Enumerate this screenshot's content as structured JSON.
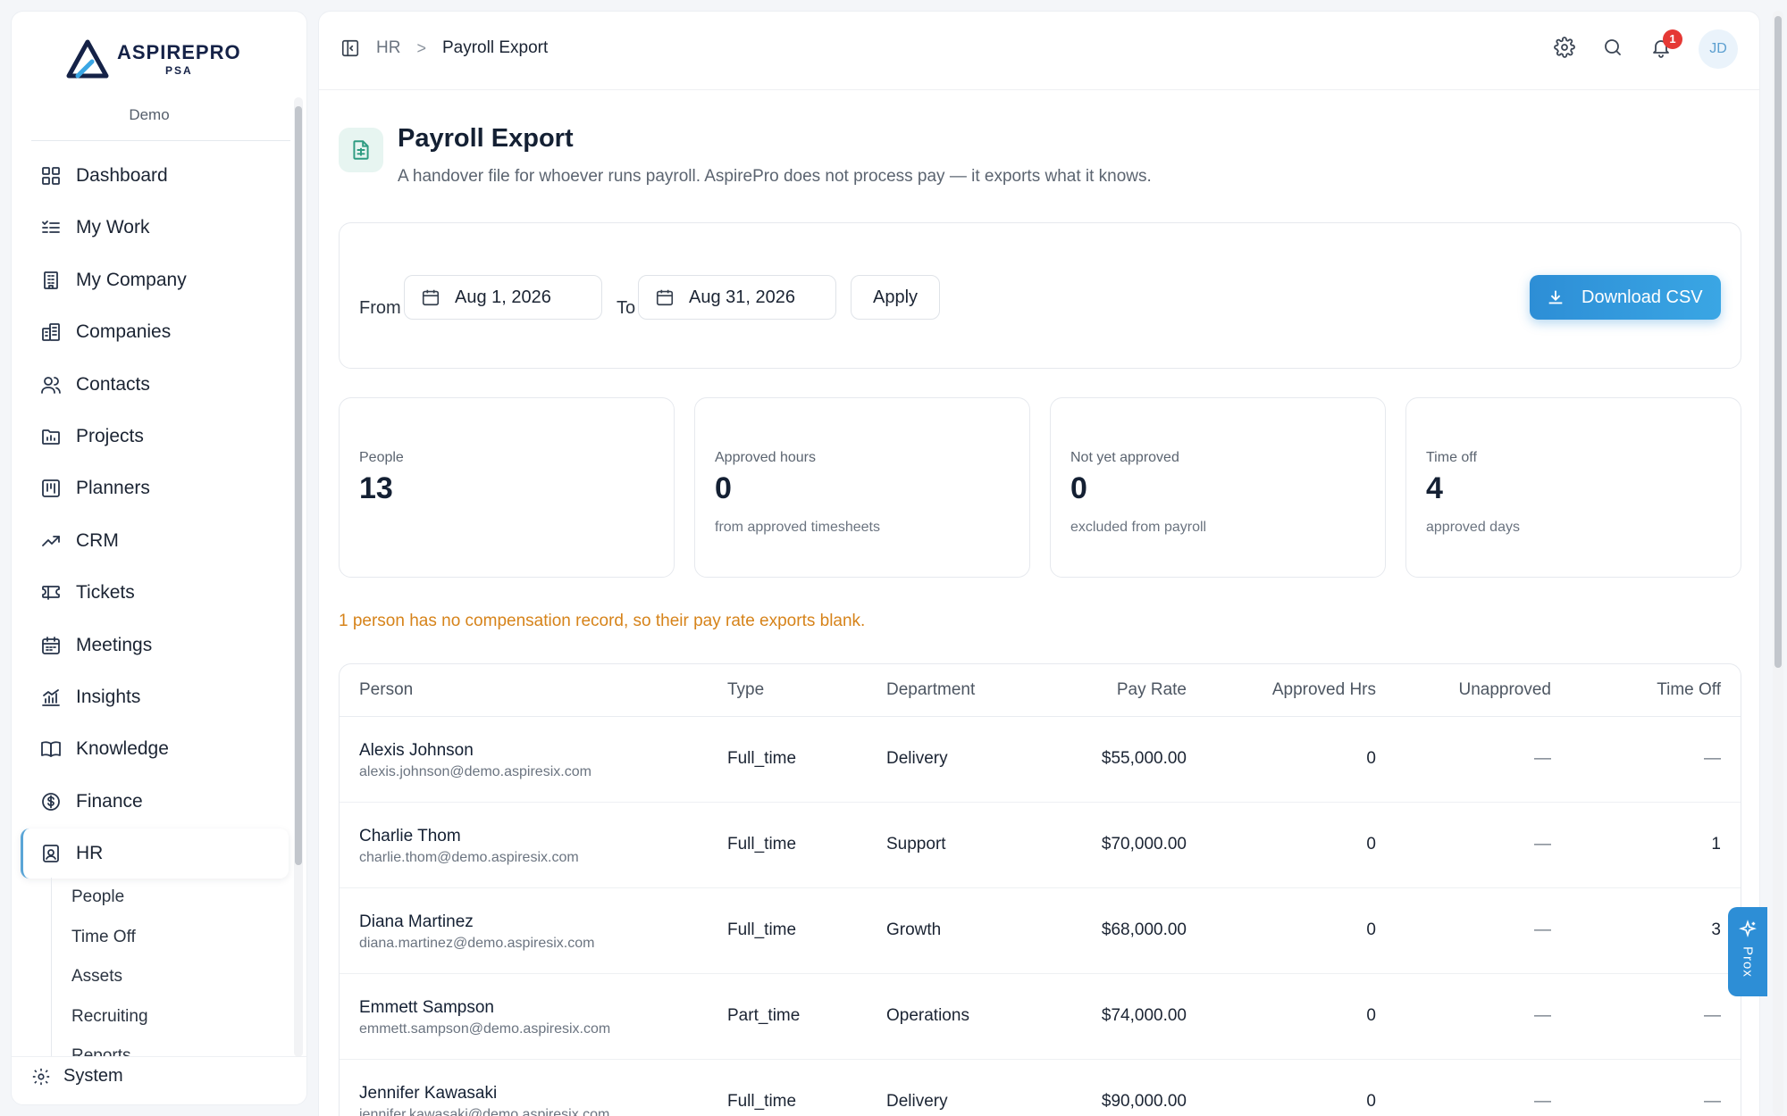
{
  "sidebar": {
    "brand": "ASPIREPRO",
    "brand_sub": "PSA",
    "workspace": "Demo",
    "items": [
      {
        "label": "Dashboard",
        "icon": "grid-icon"
      },
      {
        "label": "My Work",
        "icon": "list-check-icon"
      },
      {
        "label": "My Company",
        "icon": "building-icon"
      },
      {
        "label": "Companies",
        "icon": "buildings-icon"
      },
      {
        "label": "Contacts",
        "icon": "users-icon"
      },
      {
        "label": "Projects",
        "icon": "folder-chart-icon"
      },
      {
        "label": "Planners",
        "icon": "kanban-icon"
      },
      {
        "label": "CRM",
        "icon": "trend-up-icon"
      },
      {
        "label": "Tickets",
        "icon": "ticket-icon"
      },
      {
        "label": "Meetings",
        "icon": "calendar-icon"
      },
      {
        "label": "Insights",
        "icon": "bar-chart-icon"
      },
      {
        "label": "Knowledge",
        "icon": "book-icon"
      },
      {
        "label": "Finance",
        "icon": "dollar-circle-icon"
      },
      {
        "label": "HR",
        "icon": "id-badge-icon",
        "active": true
      }
    ],
    "sub_items": [
      "People",
      "Time Off",
      "Assets",
      "Recruiting",
      "Reports"
    ],
    "system_label": "System"
  },
  "topbar": {
    "crumb_section": "HR",
    "crumb_separator": ">",
    "crumb_current": "Payroll Export",
    "notification_count": "1",
    "avatar_initials": "JD"
  },
  "page": {
    "title": "Payroll Export",
    "subtitle": "A handover file for whoever runs payroll. AspirePro does not process pay — it exports what it knows."
  },
  "filters": {
    "from_label": "From",
    "from_value": "Aug 1, 2026",
    "to_label": "To",
    "to_value": "Aug 31, 2026",
    "apply_label": "Apply",
    "download_label": "Download CSV"
  },
  "stats": [
    {
      "label": "People",
      "value": "13",
      "hint": ""
    },
    {
      "label": "Approved hours",
      "value": "0",
      "hint": "from approved timesheets"
    },
    {
      "label": "Not yet approved",
      "value": "0",
      "hint": "excluded from payroll"
    },
    {
      "label": "Time off",
      "value": "4",
      "hint": "approved days"
    }
  ],
  "warning": "1 person has no compensation record, so their pay rate exports blank.",
  "table": {
    "columns": [
      "Person",
      "Type",
      "Department",
      "Pay Rate",
      "Approved Hrs",
      "Unapproved",
      "Time Off"
    ],
    "rows": [
      {
        "name": "Alexis Johnson",
        "email": "alexis.johnson@demo.aspiresix.com",
        "type": "Full_time",
        "department": "Delivery",
        "pay_rate": "$55,000.00",
        "approved": "0",
        "unapproved": "—",
        "time_off": "—"
      },
      {
        "name": "Charlie Thom",
        "email": "charlie.thom@demo.aspiresix.com",
        "type": "Full_time",
        "department": "Support",
        "pay_rate": "$70,000.00",
        "approved": "0",
        "unapproved": "—",
        "time_off": "1"
      },
      {
        "name": "Diana Martinez",
        "email": "diana.martinez@demo.aspiresix.com",
        "type": "Full_time",
        "department": "Growth",
        "pay_rate": "$68,000.00",
        "approved": "0",
        "unapproved": "—",
        "time_off": "3"
      },
      {
        "name": "Emmett Sampson",
        "email": "emmett.sampson@demo.aspiresix.com",
        "type": "Part_time",
        "department": "Operations",
        "pay_rate": "$74,000.00",
        "approved": "0",
        "unapproved": "—",
        "time_off": "—"
      },
      {
        "name": "Jennifer Kawasaki",
        "email": "jennifer.kawasaki@demo.aspiresix.com",
        "type": "Full_time",
        "department": "Delivery",
        "pay_rate": "$90,000.00",
        "approved": "0",
        "unapproved": "—",
        "time_off": "—"
      }
    ]
  },
  "prox": {
    "label": "Prox"
  }
}
